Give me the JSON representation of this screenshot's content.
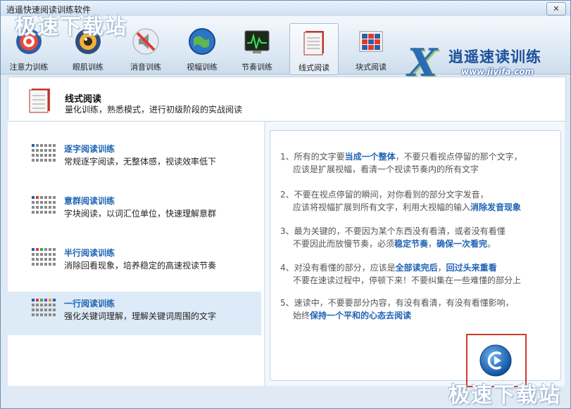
{
  "window": {
    "title": "逍遥快速阅读训练软件",
    "close_label": "✕"
  },
  "watermark": {
    "text": "极速下载站"
  },
  "toolbar": {
    "items": [
      {
        "label": "注意力训练",
        "icon": "target-icon"
      },
      {
        "label": "眼肌训练",
        "icon": "eye-icon"
      },
      {
        "label": "消音训练",
        "icon": "mute-icon"
      },
      {
        "label": "视幅训练",
        "icon": "globe-icon"
      },
      {
        "label": "节奏训练",
        "icon": "pulse-monitor-icon"
      },
      {
        "label": "线式阅读",
        "icon": "notebook-icon"
      },
      {
        "label": "块式阅读",
        "icon": "blocks-icon"
      }
    ],
    "active_index": 5
  },
  "logo": {
    "mark": "X",
    "title": "逍遥速读训练",
    "url": "www.jiyifa.com"
  },
  "header": {
    "title": "线式阅读",
    "subtitle": "量化训练，熟悉模式，进行初级阶段的实战阅读"
  },
  "modes": [
    {
      "title": "逐字阅读训练",
      "desc": "常规逐字阅读，无整体感，视读效率低下"
    },
    {
      "title": "意群阅读训练",
      "desc": "字块阅读，以词汇位单位，快速理解意群"
    },
    {
      "title": "半行阅读训练",
      "desc": "消除回看现象，培养稳定的高速视读节奏"
    },
    {
      "title": "一行阅读训练",
      "desc": "强化关键词理解，理解关键词周围的文字"
    }
  ],
  "selected_mode": 3,
  "tips": [
    {
      "a": "1、所有的文字要",
      "b": "当成一个整体",
      "c": "，不要只看视点停留的那个文字，",
      "d": "应该是扩展视幅，看清一个视读节奏内的所有文字"
    },
    {
      "a": "2、不要在视点停留的瞬间，对你看到的部分文字发音，",
      "d1": "应该将视幅扩展到所有文字，利用大视幅的输入",
      "e": "消除发音现象"
    },
    {
      "a": "3、最为关键的，不要因为某个东西没有看清，或者没有看懂",
      "d1": "不要因此而放慢节奏，必须",
      "e": "稳定节奏",
      "f": "，",
      "g": "确保一次看完",
      "h": "。"
    },
    {
      "a": "4、对没有看懂的部分，应该是",
      "b": "全部读完后",
      "c": "，",
      "b2": "回过头来重看",
      "d": "不要在速读过程中，停顿下来！不要纠集在一些难懂的部分上"
    },
    {
      "a": "5、速读中，不要要部分内容，有没有看清，有没有看懂影响，",
      "d1": "始终",
      "e": "保持一个平和的心态去阅读"
    }
  ],
  "colors": {
    "accent": "#1f63b5",
    "highlight_frame": "#d23a2a",
    "selected_bg": "#ddeaf7"
  }
}
